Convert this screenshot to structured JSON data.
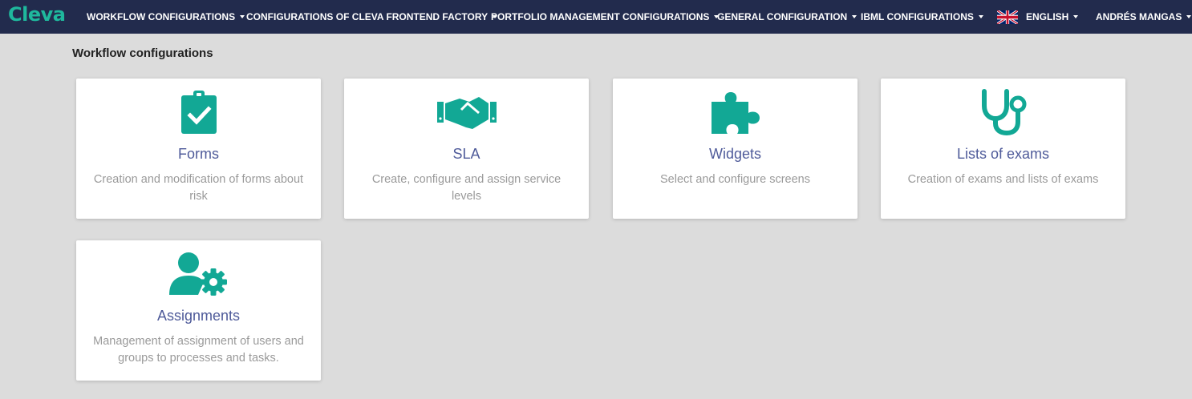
{
  "app": {
    "logo_text": "Cleva",
    "brand_color": "#1fb89d",
    "nav_bg": "#222b4d"
  },
  "nav": {
    "items": [
      {
        "label": "WORKFLOW CONFIGURATIONS"
      },
      {
        "label": "CONFIGURATIONS OF CLEVA FRONTEND FACTORY"
      },
      {
        "label": "PORTFOLIO MANAGEMENT CONFIGURATIONS"
      },
      {
        "label": "GENERAL CONFIGURATION"
      },
      {
        "label": "IBML CONFIGURATIONS"
      }
    ],
    "language": {
      "label": "ENGLISH",
      "flag_icon": "uk-flag-icon"
    },
    "user": {
      "label": "ANDRÉS MANGAS"
    }
  },
  "page": {
    "title": "Workflow configurations"
  },
  "cards": [
    {
      "title": "Forms",
      "description": "Creation and modification of forms about risk",
      "icon": "clipboard-check-icon"
    },
    {
      "title": "SLA",
      "description": "Create, configure and assign service levels",
      "icon": "handshake-icon"
    },
    {
      "title": "Widgets",
      "description": "Select and configure screens",
      "icon": "puzzle-piece-icon"
    },
    {
      "title": "Lists of exams",
      "description": "Creation of exams and lists of exams",
      "icon": "stethoscope-icon"
    },
    {
      "title": "Assignments",
      "description": "Management of assignment of users and groups to processes and tasks.",
      "icon": "user-gear-icon"
    }
  ],
  "icon_color": "#12a895"
}
